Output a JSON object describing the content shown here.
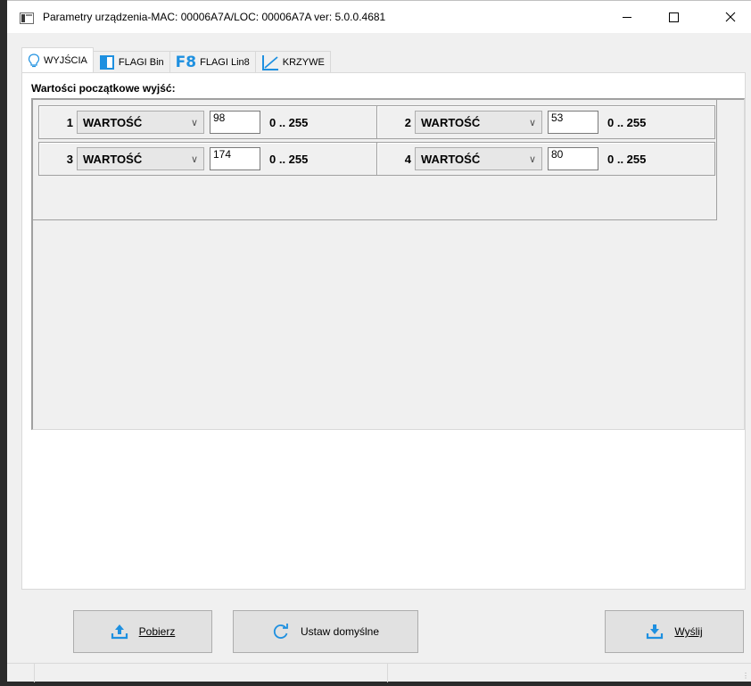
{
  "window": {
    "title": "Parametry urządzenia-MAC: 00006A7A/LOC: 00006A7A ver: 5.0.0.4681",
    "minimize_icon": "minimize-icon",
    "maximize_icon": "maximize-icon",
    "close_icon": "close-icon"
  },
  "tabs": [
    {
      "label": "WYJŚCIA",
      "icon": "lightbulb-icon",
      "active": true
    },
    {
      "label": "FLAGI Bin",
      "icon": "flag-bin-icon",
      "active": false
    },
    {
      "label": "FLAGI Lin8",
      "icon": "f8-icon",
      "icon_text": "F8",
      "active": false
    },
    {
      "label": "KRZYWE",
      "icon": "curve-icon",
      "active": false
    }
  ],
  "section": {
    "title": "Wartości początkowe wyjść:"
  },
  "outputs": [
    {
      "index": "1",
      "mode": "WARTOŚĆ",
      "value": "98",
      "range": "0 .. 255"
    },
    {
      "index": "2",
      "mode": "WARTOŚĆ",
      "value": "53",
      "range": "0 .. 255"
    },
    {
      "index": "3",
      "mode": "WARTOŚĆ",
      "value": "174",
      "range": "0 .. 255"
    },
    {
      "index": "4",
      "mode": "WARTOŚĆ",
      "value": "80",
      "range": "0 .. 255"
    }
  ],
  "buttons": {
    "download": {
      "label": "Pobierz",
      "icon": "upload-icon"
    },
    "defaults": {
      "label": "Ustaw domyślne",
      "icon": "refresh-icon"
    },
    "send": {
      "label": "Wyślij",
      "icon": "download-icon"
    }
  },
  "colors": {
    "accent": "#1e90e0",
    "panel_bg": "#f0f0f0"
  }
}
